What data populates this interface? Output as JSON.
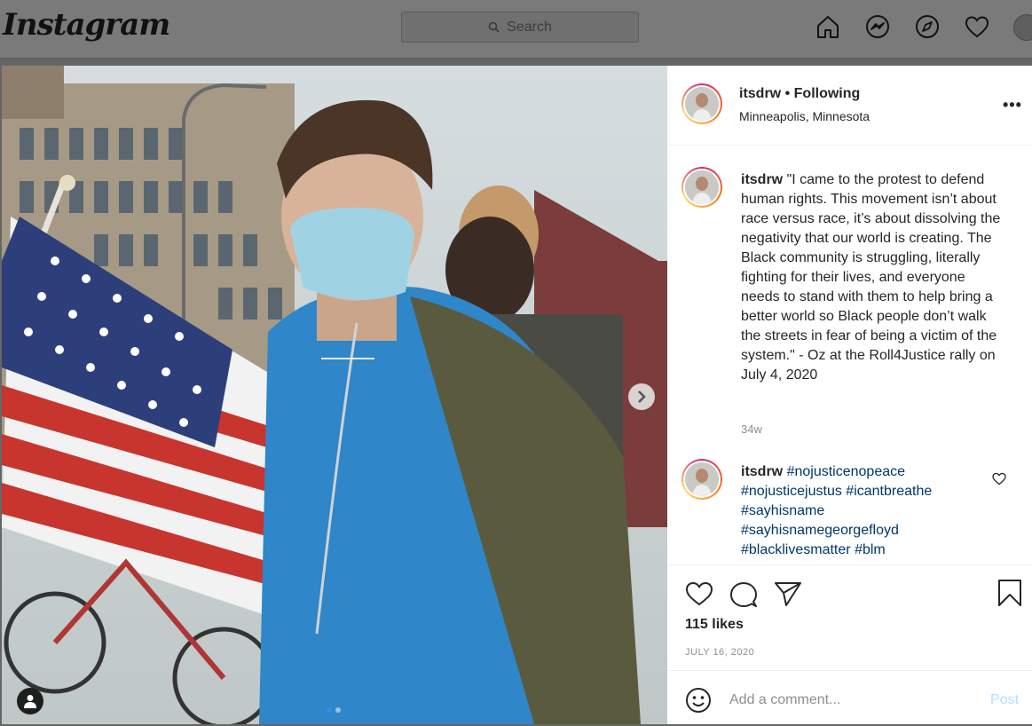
{
  "nav": {
    "logo": "Instagram",
    "search_placeholder": "Search",
    "icons": [
      "home-icon",
      "messenger-icon",
      "explore-icon",
      "activity-heart-icon",
      "profile-avatar"
    ]
  },
  "post": {
    "username": "itsdrw",
    "separator": "•",
    "follow_status": "Following",
    "location": "Minneapolis, Minnesota",
    "more": "•••",
    "caption": {
      "username": "itsdrw",
      "text": "\"I came to the protest to defend human rights. This movement isn’t about race versus race, it’s about dissolving the negativity that our world is creating. The Black community is struggling, literally fighting for their lives, and everyone needs to stand with them to help bring a better world so Black people don’t walk the streets in fear of being a victim of the system.\" - Oz at the Roll4Justice rally on July 4, 2020",
      "age": "34w"
    },
    "hashtag_comment": {
      "username": "itsdrw",
      "tags": [
        "#nojusticenopeace",
        "#nojusticejustus",
        "#icantbreathe",
        "#sayhisname",
        "#sayhisnamegeorgefloyd",
        "#blacklivesmatter",
        "#blm"
      ]
    },
    "likes": "115 likes",
    "date": "JULY 16, 2020",
    "comment_placeholder": "Add a comment...",
    "post_button": "Post"
  },
  "carousel": {
    "slide_count": 2,
    "current": 1
  },
  "colors": {
    "link": "#00376b",
    "post_disabled": "#b2dffc",
    "dot_active": "#2f8ef0"
  }
}
